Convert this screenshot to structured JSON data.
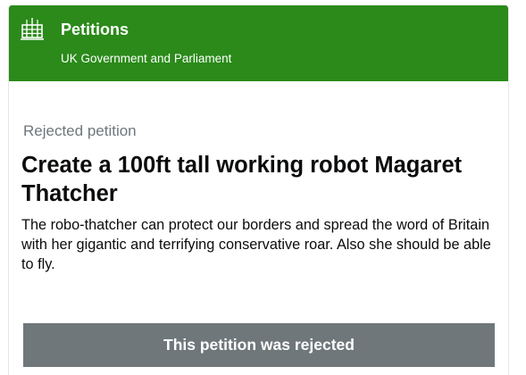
{
  "header": {
    "title": "Petitions",
    "subtitle": "UK Government and Parliament",
    "logo_icon": "portcullis-icon",
    "background_color": "#2b8a1a"
  },
  "petition": {
    "status_label": "Rejected petition",
    "title": "Create a 100ft tall working robot Magaret Thatcher",
    "description": "The robo-thatcher can protect our borders and spread the word of Britain with her gigantic and terrifying conservative roar. Also she should be able to fly.",
    "rejected_banner": "This petition was rejected",
    "banner_color": "#6f777b"
  }
}
